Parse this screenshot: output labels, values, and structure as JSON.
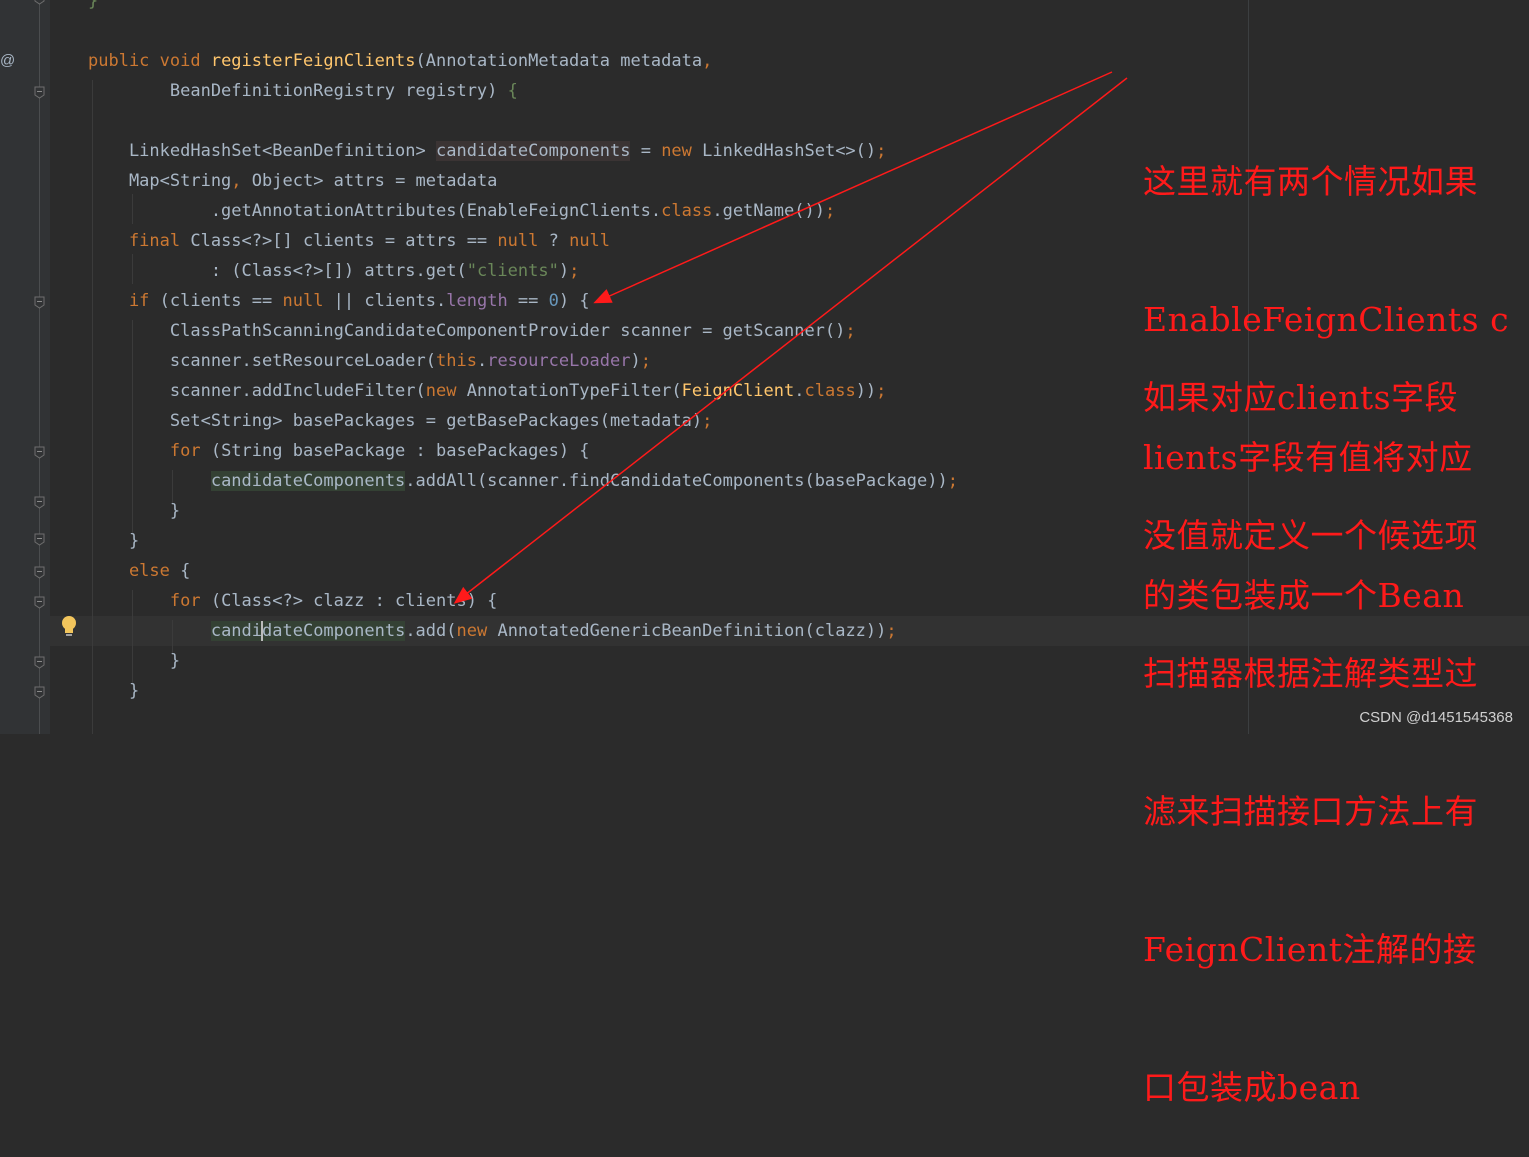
{
  "editor": {
    "impl_marker": "@",
    "lines": [
      [
        {
          "t": "}",
          "c": "str"
        }
      ],
      [],
      [
        {
          "t": "public void ",
          "c": "kw"
        },
        {
          "t": "registerFeignClients",
          "c": "fn"
        },
        {
          "t": "(AnnotationMetadata metadata",
          "c": ""
        },
        {
          "t": ",",
          "c": "kw"
        }
      ],
      [
        {
          "t": "        BeanDefinitionRegistry registry) ",
          "c": ""
        },
        {
          "t": "{",
          "c": "str"
        }
      ],
      [],
      [
        {
          "t": "    LinkedHashSet<BeanDefinition> ",
          "c": ""
        },
        {
          "t": "candidateComponents",
          "c": "hl2"
        },
        {
          "t": " = ",
          "c": ""
        },
        {
          "t": "new ",
          "c": "kw"
        },
        {
          "t": "LinkedHashSet<>()",
          "c": ""
        },
        {
          "t": ";",
          "c": "kw"
        }
      ],
      [
        {
          "t": "    Map<String",
          "c": ""
        },
        {
          "t": ", ",
          "c": "kw"
        },
        {
          "t": "Object> attrs = metadata",
          "c": ""
        }
      ],
      [
        {
          "t": "            .getAnnotationAttributes(EnableFeignClients.",
          "c": ""
        },
        {
          "t": "class",
          "c": "kw"
        },
        {
          "t": ".getName())",
          "c": ""
        },
        {
          "t": ";",
          "c": "kw"
        }
      ],
      [
        {
          "t": "    final ",
          "c": "kw"
        },
        {
          "t": "Class<?>[] clients = attrs == ",
          "c": ""
        },
        {
          "t": "null ",
          "c": "kw"
        },
        {
          "t": "? ",
          "c": ""
        },
        {
          "t": "null",
          "c": "kw"
        }
      ],
      [
        {
          "t": "            : (Class<?>[]) attrs.get(",
          "c": ""
        },
        {
          "t": "\"clients\"",
          "c": "str"
        },
        {
          "t": ")",
          "c": ""
        },
        {
          "t": ";",
          "c": "kw"
        }
      ],
      [
        {
          "t": "    if ",
          "c": "kw"
        },
        {
          "t": "(clients == ",
          "c": ""
        },
        {
          "t": "null ",
          "c": "kw"
        },
        {
          "t": "|| clients.",
          "c": ""
        },
        {
          "t": "length",
          "c": "fld"
        },
        {
          "t": " == ",
          "c": ""
        },
        {
          "t": "0",
          "c": "num"
        },
        {
          "t": ") {",
          "c": ""
        }
      ],
      [
        {
          "t": "        ClassPathScanningCandidateComponentProvider scanner = getScanner()",
          "c": ""
        },
        {
          "t": ";",
          "c": "kw"
        }
      ],
      [
        {
          "t": "        scanner.setResourceLoader(",
          "c": ""
        },
        {
          "t": "this",
          "c": "kw"
        },
        {
          "t": ".",
          "c": ""
        },
        {
          "t": "resourceLoader",
          "c": "fld"
        },
        {
          "t": ")",
          "c": ""
        },
        {
          "t": ";",
          "c": "kw"
        }
      ],
      [
        {
          "t": "        scanner.addIncludeFilter(",
          "c": ""
        },
        {
          "t": "new ",
          "c": "kw"
        },
        {
          "t": "AnnotationTypeFilter(",
          "c": ""
        },
        {
          "t": "FeignClient",
          "c": "fn"
        },
        {
          "t": ".",
          "c": ""
        },
        {
          "t": "class",
          "c": "kw"
        },
        {
          "t": "))",
          "c": ""
        },
        {
          "t": ";",
          "c": "kw"
        }
      ],
      [
        {
          "t": "        Set<String> basePackages = getBasePackages(metadata)",
          "c": ""
        },
        {
          "t": ";",
          "c": "kw"
        }
      ],
      [
        {
          "t": "        for ",
          "c": "kw"
        },
        {
          "t": "(String basePackage : basePackages) {",
          "c": ""
        }
      ],
      [
        {
          "t": "            ",
          "c": ""
        },
        {
          "t": "candidateComponents",
          "c": "hl"
        },
        {
          "t": ".addAll(scanner.findCandidateComponents(basePackage))",
          "c": ""
        },
        {
          "t": ";",
          "c": "kw"
        }
      ],
      [
        {
          "t": "        }",
          "c": ""
        }
      ],
      [
        {
          "t": "    }",
          "c": ""
        }
      ],
      [
        {
          "t": "    else ",
          "c": "kw"
        },
        {
          "t": "{",
          "c": ""
        }
      ],
      [
        {
          "t": "        for ",
          "c": "kw"
        },
        {
          "t": "(Class<?> clazz : clients) {",
          "c": ""
        }
      ],
      [
        {
          "t": "            ",
          "c": ""
        },
        {
          "t": "candidateComponents",
          "c": "hl",
          "cursor": 5
        },
        {
          "t": ".add(",
          "c": ""
        },
        {
          "t": "new ",
          "c": "kw"
        },
        {
          "t": "AnnotatedGenericBeanDefinition(clazz))",
          "c": ""
        },
        {
          "t": ";",
          "c": "kw"
        }
      ],
      [
        {
          "t": "        }",
          "c": ""
        }
      ],
      [
        {
          "t": "    }",
          "c": ""
        }
      ]
    ]
  },
  "annotations": {
    "color": "#ff1a1a",
    "note_1": [
      "这里就有两个情况如果",
      "EnableFeignClients c",
      "lients字段有值将对应",
      "的类包装成一个Bean"
    ],
    "note_2": [
      "如果对应clients字段",
      "没值就定义一个候选项",
      "扫描器根据注解类型过",
      "滤来扫描接口方法上有",
      "FeignClient注解的接",
      "口包装成bean"
    ]
  },
  "watermark": "CSDN @d1451545368"
}
